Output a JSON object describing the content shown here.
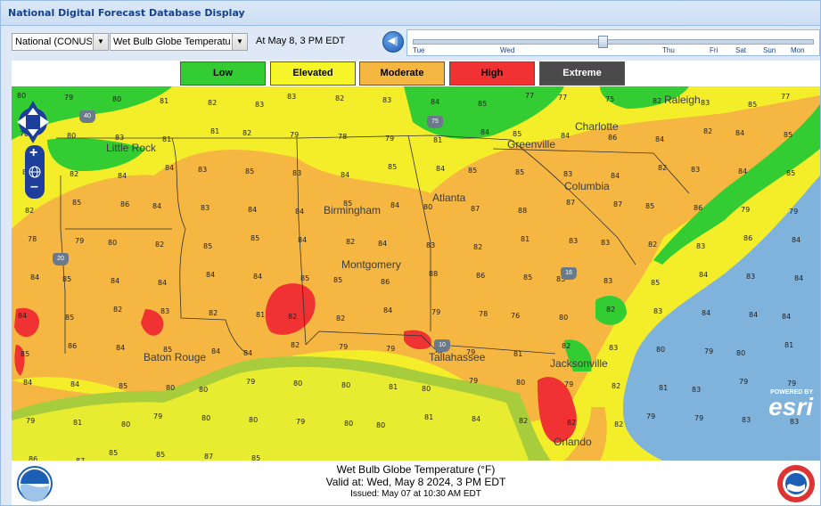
{
  "window": {
    "title": "National Digital Forecast Database Display"
  },
  "toolbar": {
    "region_value": "National (CONUS",
    "element_value": "Wet Bulb Globe Temperatu",
    "valid_label": "At May   8,   3 PM EDT",
    "play_icon": "play-back-icon",
    "timeline_days": [
      "Tue",
      "Wed",
      "Thu",
      "Fri",
      "Sat",
      "Sun",
      "Mon"
    ],
    "timeline_position": 0.47
  },
  "legend": [
    {
      "label": "Low",
      "color": "#33cc33",
      "text_color": "#000000"
    },
    {
      "label": "Elevated",
      "color": "#f5f52a",
      "text_color": "#000000"
    },
    {
      "label": "Moderate",
      "color": "#f5b642",
      "text_color": "#000000"
    },
    {
      "label": "High",
      "color": "#f03232",
      "text_color": "#000000"
    },
    {
      "label": "Extreme",
      "color": "#4a4a4a",
      "text_color": "#ffffff"
    }
  ],
  "map": {
    "cities": [
      "Little Rock",
      "Birmingham",
      "Atlanta",
      "Greenville",
      "Charlotte",
      "Raleigh",
      "Columbia",
      "Montgomery",
      "Baton Rouge",
      "Tallahassee",
      "Jacksonville",
      "Orlando"
    ],
    "highways": [
      "40",
      "75",
      "20",
      "16",
      "10"
    ],
    "values": [
      "80",
      "79",
      "80",
      "81",
      "82",
      "83",
      "83",
      "82",
      "83",
      "84",
      "85",
      "77",
      "77",
      "75",
      "82",
      "83",
      "85",
      "77",
      "78",
      "80",
      "83",
      "81",
      "81",
      "82",
      "79",
      "78",
      "79",
      "81",
      "84",
      "85",
      "84",
      "86",
      "84",
      "82",
      "84",
      "85",
      "83",
      "82",
      "84",
      "84",
      "83",
      "85",
      "83",
      "84",
      "85",
      "84",
      "85",
      "85",
      "83",
      "84",
      "82",
      "83",
      "84",
      "85",
      "82",
      "85",
      "86",
      "84",
      "83",
      "84",
      "84",
      "85",
      "84",
      "80",
      "87",
      "88",
      "87",
      "87",
      "85",
      "86",
      "79",
      "79",
      "78",
      "79",
      "80",
      "82",
      "85",
      "85",
      "84",
      "82",
      "84",
      "83",
      "82",
      "81",
      "83",
      "83",
      "82",
      "83",
      "86",
      "84",
      "84",
      "85",
      "84",
      "84",
      "84",
      "84",
      "85",
      "85",
      "86",
      "88",
      "86",
      "85",
      "85",
      "83",
      "85",
      "84",
      "83",
      "84",
      "84",
      "85",
      "82",
      "83",
      "82",
      "81",
      "82",
      "82",
      "84",
      "79",
      "78",
      "76",
      "80",
      "82",
      "83",
      "84",
      "84",
      "84",
      "85",
      "86",
      "84",
      "85",
      "84",
      "84",
      "82",
      "79",
      "79",
      "78",
      "79",
      "81",
      "82",
      "83",
      "80",
      "79",
      "80",
      "81",
      "84",
      "84",
      "85",
      "80",
      "80",
      "79",
      "80",
      "80",
      "81",
      "80",
      "79",
      "80",
      "79",
      "82",
      "81",
      "83",
      "79",
      "79",
      "79",
      "81",
      "80",
      "79",
      "80",
      "80",
      "79",
      "80",
      "80",
      "81",
      "84",
      "82",
      "82",
      "82",
      "79",
      "79",
      "83",
      "83",
      "86",
      "87",
      "85",
      "85",
      "87",
      "85"
    ],
    "zoom_in_icon": "plus-icon",
    "zoom_out_icon": "minus-icon",
    "globe_icon": "globe-icon",
    "pan_icon": "pan-arrows-icon",
    "attribution_small": "POWERED BY",
    "attribution_brand": "esri"
  },
  "footer": {
    "title": "Wet Bulb Globe Temperature (°F)",
    "valid": "Valid at: Wed, May   8 2024,    3 PM EDT",
    "issued": "Issued: May 07 at 10:30 AM EDT",
    "left_logo": "NOAA",
    "right_logo": "National Weather Service"
  }
}
